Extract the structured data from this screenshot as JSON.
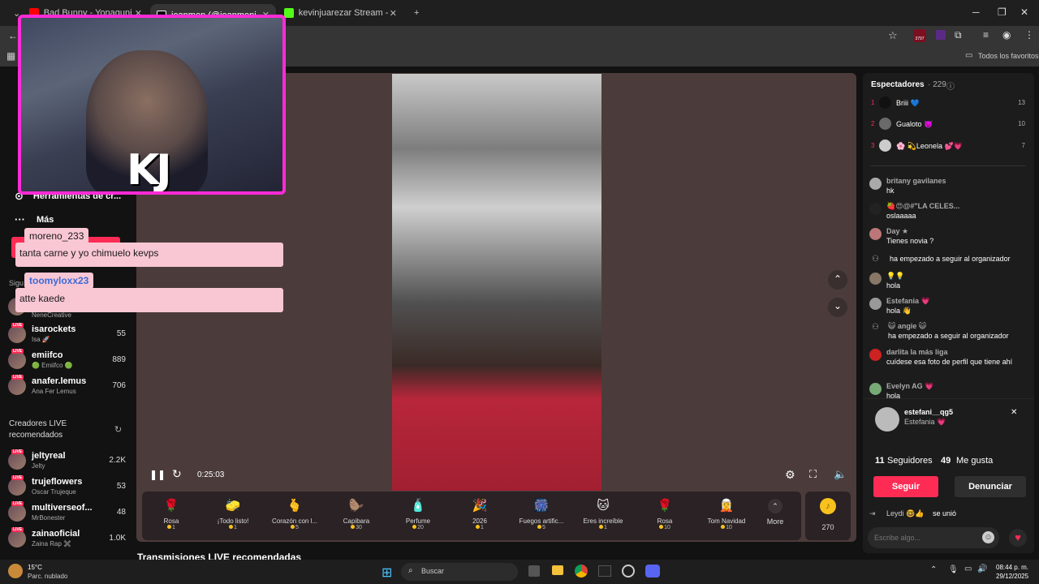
{
  "browser": {
    "tabs": [
      {
        "title": "Bad Bunny - Yonaguni (Video O...",
        "color": "#ff0000"
      },
      {
        "title": "jeanmen (@jeanmeni) esti...",
        "color": "#ffffff",
        "active": true
      },
      {
        "title": "kevinjuarezar Stream - Watch L...",
        "color": "#53fc18"
      }
    ],
    "new_tab": "+",
    "extension_badge": "3797",
    "bookmarks_all": "Todos los favoritos"
  },
  "sidebar": {
    "tools_label": "Herramientas de cr...",
    "more_label": "Más",
    "following_header": "Sigu",
    "following": [
      {
        "name": "",
        "sub": "NeneCreative",
        "count": ""
      },
      {
        "name": "isarockets",
        "sub": "Isa 🚀",
        "count": "55"
      },
      {
        "name": "emiifco",
        "sub": "🟢 Emiifco 🟢",
        "count": "889"
      },
      {
        "name": "anafer.lemus",
        "sub": "Ana Fer Lemus",
        "count": "706"
      }
    ],
    "recommended_header": "Creadores LIVE recomendados",
    "recommended": [
      {
        "name": "jeltyreal",
        "sub": "Jelty",
        "count": "2.2K"
      },
      {
        "name": "trujeflowers",
        "sub": "Oscar Trujeque",
        "count": "53"
      },
      {
        "name": "multiverseof...",
        "sub": "MrBonester",
        "count": "48"
      },
      {
        "name": "zainaoficial",
        "sub": "Zaina Rap ✖️",
        "count": "1.0K"
      }
    ],
    "live_tag": "LIVE"
  },
  "overlay": {
    "logo_text": "KJ",
    "chat_user_1": "moreno_233",
    "chat_msg_1": "tanta carne y yo chimuelo kevps",
    "chat_user_2": "toomyloxx23",
    "chat_msg_2": "atte kaede"
  },
  "player": {
    "time": "0:25:03"
  },
  "gifts": [
    {
      "name": "Rosa",
      "price": "1",
      "icon": "🌹"
    },
    {
      "name": "¡Todo listo!",
      "price": "1",
      "icon": "🧽"
    },
    {
      "name": "Corazón con l...",
      "price": "5",
      "icon": "🫰"
    },
    {
      "name": "Capibara",
      "price": "30",
      "icon": "🦫"
    },
    {
      "name": "Perfume",
      "price": "20",
      "icon": "🧴"
    },
    {
      "name": "2026",
      "price": "1",
      "icon": "🎉"
    },
    {
      "name": "Fuegos artific...",
      "price": "5",
      "icon": "🎆"
    },
    {
      "name": "Eres increíble",
      "price": "1",
      "icon": "🐱"
    },
    {
      "name": "Rosa",
      "price": "10",
      "icon": "🌹"
    },
    {
      "name": "Tom Navidad",
      "price": "10",
      "icon": "🧝"
    }
  ],
  "gifts_more": "More",
  "coins": "270",
  "chat": {
    "viewers_label": "Espectadores",
    "viewers_count": "· 229",
    "top": [
      {
        "rank": "1",
        "name": "Briii 💙",
        "score": "13"
      },
      {
        "rank": "2",
        "name": "Gualoto 👿",
        "score": "10"
      },
      {
        "rank": "3",
        "name": "🌸 💫Leonela 💕💗",
        "score": "7"
      }
    ],
    "messages": [
      {
        "user": "britany gavilanes",
        "text": "hk"
      },
      {
        "user": "🍓😍@#\"LA CELES...",
        "text": "oslaaaaa"
      },
      {
        "user": "Day ★",
        "text": "Tienes novia ?"
      },
      {
        "user": "",
        "text": "ha empezado a seguir al organizador"
      },
      {
        "user": "💡💡",
        "text": "hola"
      },
      {
        "user": "Estefania 💗",
        "text": "hola 👋"
      },
      {
        "user": "😺 angie 😺",
        "text": "ha empezado a seguir al organizador"
      },
      {
        "user": "darlita la más liga",
        "text": "cuídese esa foto de perfil que tiene ahí"
      },
      {
        "user": "Evelyn AG 💗",
        "text": "hola"
      }
    ],
    "profile_card": {
      "username": "estefani__qg5",
      "display": "Estefania 💗",
      "followers_count": "11",
      "followers_label": "Seguidores",
      "likes_count": "49",
      "likes_label": "Me gusta",
      "follow_btn": "Seguir",
      "report_btn": "Denunciar"
    },
    "joined_user": "Leydi 🤓👍",
    "joined_text": "se unió",
    "input_placeholder": "Escribe algo..."
  },
  "recommended_streams": "Transmisiones LIVE recomendadas",
  "taskbar": {
    "weather_temp": "15°C",
    "weather_desc": "Parc. nublado",
    "search": "Buscar",
    "time": "08:44 p. m.",
    "date": "29/12/2025"
  }
}
